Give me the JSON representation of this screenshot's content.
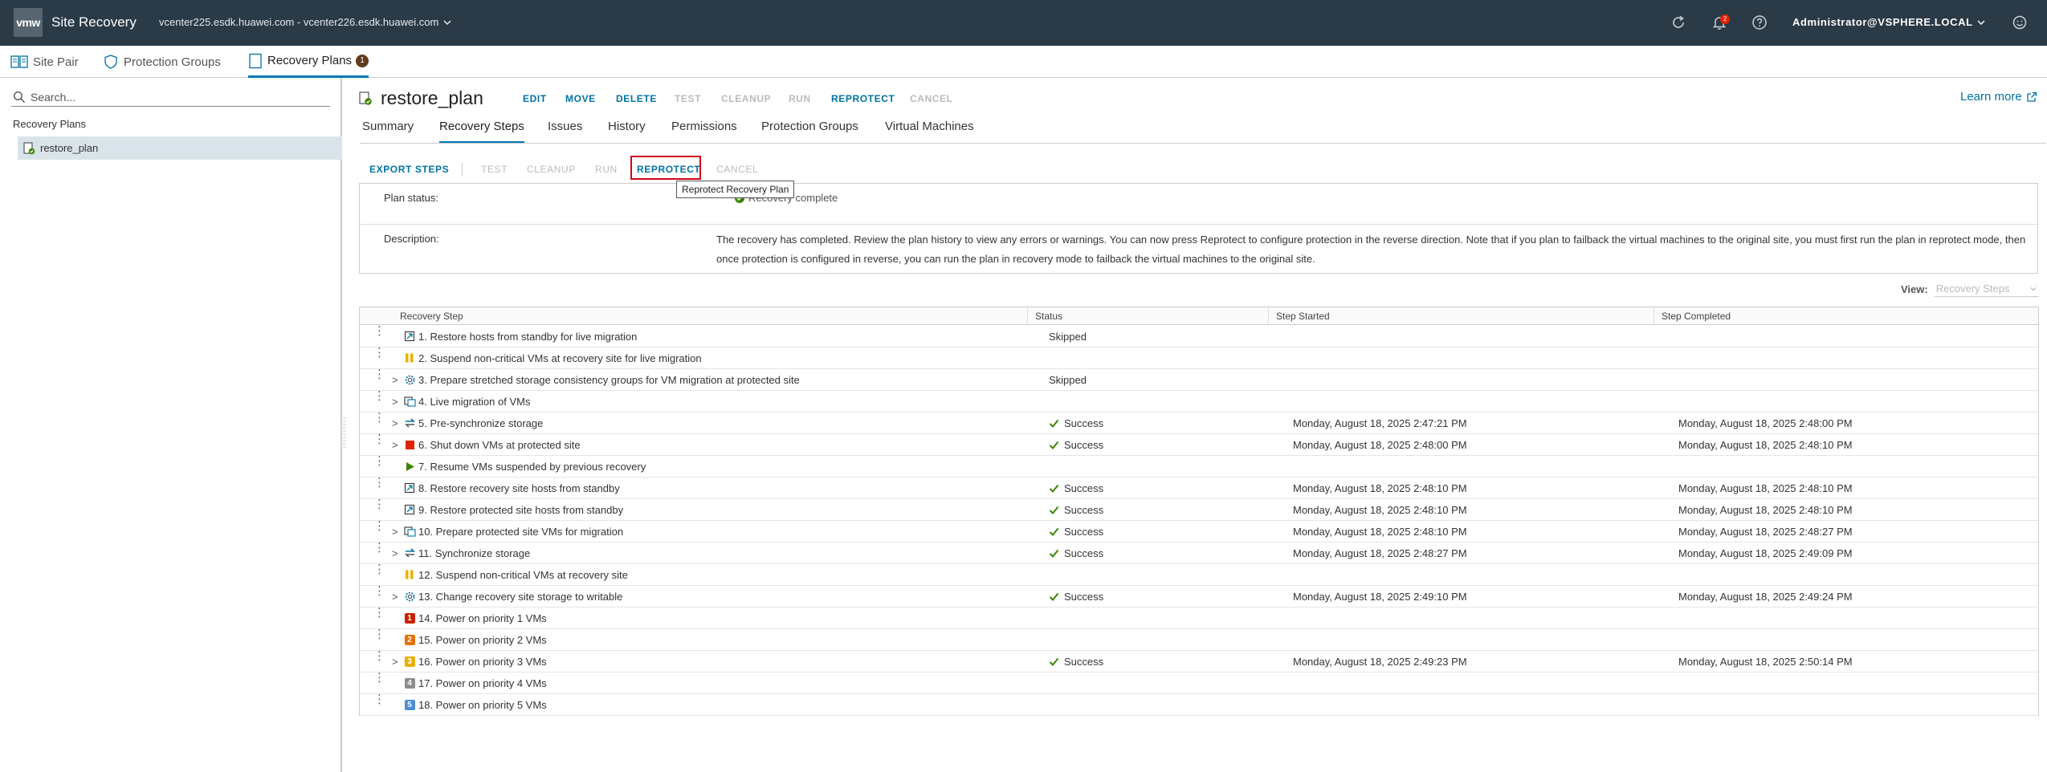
{
  "header": {
    "logo": "vmw",
    "app_title": "Site Recovery",
    "vcenter": "vcenter225.esdk.huawei.com - vcenter226.esdk.huawei.com",
    "notification_count": "2",
    "user": "Administrator@VSPHERE.LOCAL"
  },
  "subnav": {
    "site_pair": "Site Pair",
    "protection_groups": "Protection Groups",
    "recovery_plans": "Recovery Plans",
    "recovery_plans_badge": "1"
  },
  "sidebar": {
    "search_placeholder": "Search...",
    "tree_title": "Recovery Plans",
    "item": "restore_plan"
  },
  "plan": {
    "title": "restore_plan",
    "actions": {
      "edit": "EDIT",
      "move": "MOVE",
      "delete": "DELETE",
      "test": "TEST",
      "cleanup": "CLEANUP",
      "run": "RUN",
      "reprotect": "REPROTECT",
      "cancel": "CANCEL"
    },
    "learn_more": "Learn more"
  },
  "tabs": {
    "summary": "Summary",
    "recovery_steps": "Recovery Steps",
    "issues": "Issues",
    "history": "History",
    "permissions": "Permissions",
    "protection_groups": "Protection Groups",
    "virtual_machines": "Virtual Machines"
  },
  "toolbar": {
    "export": "EXPORT STEPS",
    "test": "TEST",
    "cleanup": "CLEANUP",
    "run": "RUN",
    "reprotect": "REPROTECT",
    "cancel": "CANCEL",
    "tooltip": "Reprotect Recovery Plan"
  },
  "info": {
    "status_label": "Plan status:",
    "status_value": "Recovery complete",
    "description_label": "Description:",
    "description": "The recovery has completed. Review the plan history to view any errors or warnings. You can now press Reprotect to configure protection in the reverse direction. Note that if you plan to failback the virtual machines to the original site, you must first run the plan in reprotect mode, then once protection is configured in reverse, you can run the plan in recovery mode to failback the virtual machines to the original site."
  },
  "view": {
    "label": "View:",
    "value": "Recovery Steps"
  },
  "grid": {
    "headers": {
      "step": "Recovery Step",
      "status": "Status",
      "started": "Step Started",
      "completed": "Step Completed"
    },
    "rows": [
      {
        "name": "1. Restore hosts from standby for live migration",
        "icon": "host-standby-icon",
        "expand": false,
        "status": "Skipped",
        "ok": false,
        "started": "",
        "completed": ""
      },
      {
        "name": "2. Suspend non-critical VMs at recovery site for live migration",
        "icon": "pause-icon",
        "expand": false,
        "status": "",
        "ok": false,
        "started": "",
        "completed": ""
      },
      {
        "name": "3. Prepare stretched storage consistency groups for VM migration at protected site",
        "icon": "gear-icon",
        "expand": true,
        "status": "Skipped",
        "ok": false,
        "started": "",
        "completed": ""
      },
      {
        "name": "4. Live migration of VMs",
        "icon": "vm-migrate-icon",
        "expand": true,
        "status": "",
        "ok": false,
        "started": "",
        "completed": ""
      },
      {
        "name": "5. Pre-synchronize storage",
        "icon": "sync-icon",
        "expand": true,
        "status": "Success",
        "ok": true,
        "started": "Monday, August 18, 2025 2:47:21 PM",
        "completed": "Monday, August 18, 2025 2:48:00 PM"
      },
      {
        "name": "6. Shut down VMs at protected site",
        "icon": "stop-icon",
        "expand": true,
        "status": "Success",
        "ok": true,
        "started": "Monday, August 18, 2025 2:48:00 PM",
        "completed": "Monday, August 18, 2025 2:48:10 PM"
      },
      {
        "name": "7. Resume VMs suspended by previous recovery",
        "icon": "play-icon",
        "expand": false,
        "status": "",
        "ok": false,
        "started": "",
        "completed": ""
      },
      {
        "name": "8. Restore recovery site hosts from standby",
        "icon": "host-standby-icon",
        "expand": false,
        "status": "Success",
        "ok": true,
        "started": "Monday, August 18, 2025 2:48:10 PM",
        "completed": "Monday, August 18, 2025 2:48:10 PM"
      },
      {
        "name": "9. Restore protected site hosts from standby",
        "icon": "host-standby-icon",
        "expand": false,
        "status": "Success",
        "ok": true,
        "started": "Monday, August 18, 2025 2:48:10 PM",
        "completed": "Monday, August 18, 2025 2:48:10 PM"
      },
      {
        "name": "10. Prepare protected site VMs for migration",
        "icon": "vm-migrate-icon",
        "expand": true,
        "status": "Success",
        "ok": true,
        "started": "Monday, August 18, 2025 2:48:10 PM",
        "completed": "Monday, August 18, 2025 2:48:27 PM"
      },
      {
        "name": "11. Synchronize storage",
        "icon": "sync-icon",
        "expand": true,
        "status": "Success",
        "ok": true,
        "started": "Monday, August 18, 2025 2:48:27 PM",
        "completed": "Monday, August 18, 2025 2:49:09 PM"
      },
      {
        "name": "12. Suspend non-critical VMs at recovery site",
        "icon": "pause-icon",
        "expand": false,
        "status": "",
        "ok": false,
        "started": "",
        "completed": ""
      },
      {
        "name": "13. Change recovery site storage to writable",
        "icon": "gear-icon",
        "expand": true,
        "status": "Success",
        "ok": true,
        "started": "Monday, August 18, 2025 2:49:10 PM",
        "completed": "Monday, August 18, 2025 2:49:24 PM"
      },
      {
        "name": "14. Power on priority 1 VMs",
        "icon": "priority-icon",
        "prio": "1",
        "pcolor": "#c92100",
        "expand": false,
        "status": "",
        "ok": false,
        "started": "",
        "completed": ""
      },
      {
        "name": "15. Power on priority 2 VMs",
        "icon": "priority-icon",
        "prio": "2",
        "pcolor": "#e57200",
        "expand": false,
        "status": "",
        "ok": false,
        "started": "",
        "completed": ""
      },
      {
        "name": "16. Power on priority 3 VMs",
        "icon": "priority-icon",
        "prio": "3",
        "pcolor": "#e8b000",
        "expand": true,
        "status": "Success",
        "ok": true,
        "started": "Monday, August 18, 2025 2:49:23 PM",
        "completed": "Monday, August 18, 2025 2:50:14 PM"
      },
      {
        "name": "17. Power on priority 4 VMs",
        "icon": "priority-icon",
        "prio": "4",
        "pcolor": "#8c8c8c",
        "expand": false,
        "status": "",
        "ok": false,
        "started": "",
        "completed": ""
      },
      {
        "name": "18. Power on priority 5 VMs",
        "icon": "priority-icon",
        "prio": "5",
        "pcolor": "#4a8fd4",
        "expand": false,
        "status": "",
        "ok": false,
        "started": "",
        "completed": ""
      }
    ]
  },
  "colors": {
    "header_bg": "#2a3a47",
    "accent": "#0072a3",
    "success": "#3c8500",
    "highlight": "#d0021b"
  }
}
